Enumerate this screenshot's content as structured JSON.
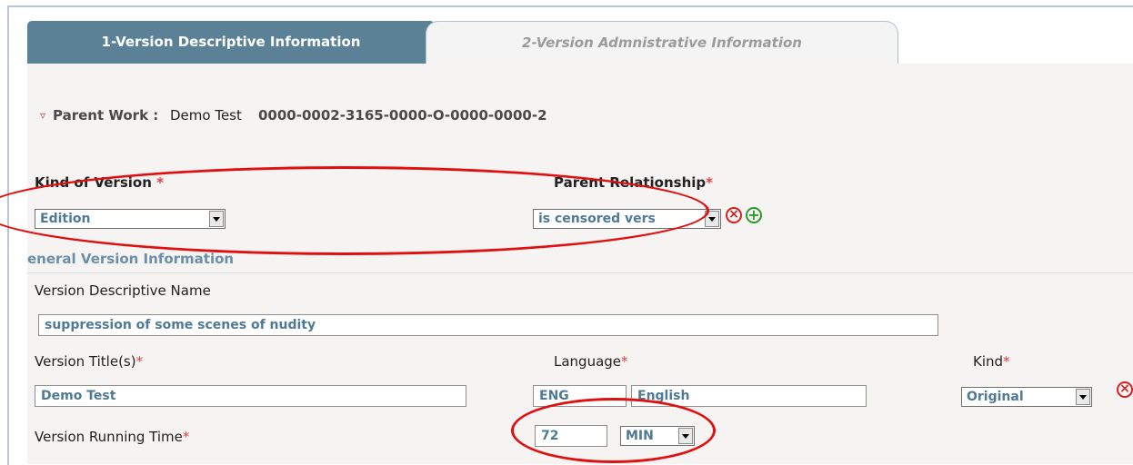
{
  "tabs": [
    {
      "label": "1-Version Descriptive Information",
      "active": true
    },
    {
      "label": "2-Version Admnistrative Information",
      "active": false
    }
  ],
  "parent_work": {
    "label": "Parent Work :",
    "title": "Demo Test",
    "id": "0000-0002-3165-0000-O-0000-0000-2"
  },
  "kind_of_version": {
    "label": "Kind of Version",
    "value": "Edition"
  },
  "parent_relationship": {
    "label": "Parent Relationship",
    "value": "is censored vers"
  },
  "section_title": "eneral Version Information",
  "descriptive_name": {
    "label": "Version Descriptive Name",
    "value": "suppression of some scenes of nudity"
  },
  "version_title": {
    "label": "Version Title(s)",
    "value": "Demo Test"
  },
  "language": {
    "label": "Language",
    "code": "ENG",
    "name": "English"
  },
  "kind": {
    "label": "Kind",
    "value": "Original"
  },
  "running_time": {
    "label": "Version Running Time",
    "value": "72",
    "unit": "MIN"
  },
  "required_mark": "*",
  "colors": {
    "tab_active": "#5b8196",
    "field_text": "#4f7a95",
    "annotation": "#e01010",
    "required": "#e04040"
  }
}
